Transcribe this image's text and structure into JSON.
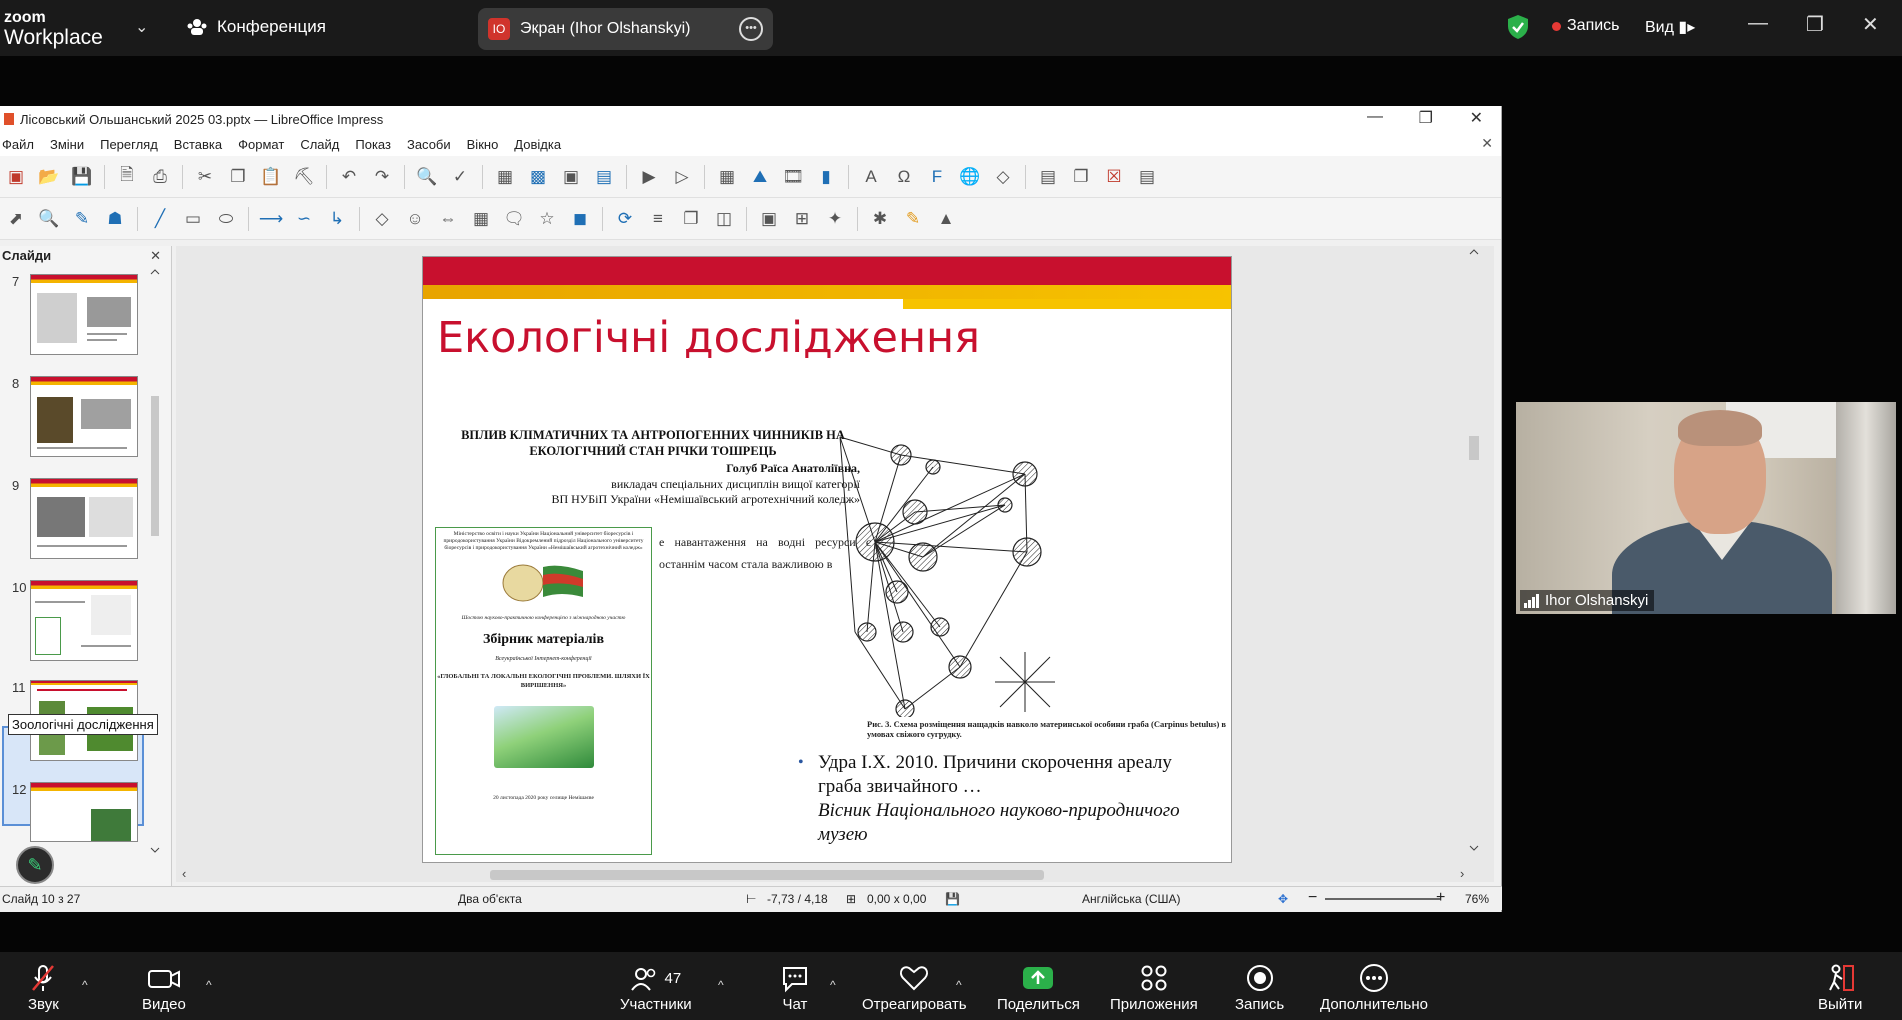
{
  "zoom": {
    "logo_line1": "zoom",
    "logo_line2": "Workplace",
    "meeting_label": "Конференция",
    "screen_share_label": "Экран (Ihor Olshanskyi)",
    "screen_share_badge": "IO",
    "recording_label": "Запись",
    "view_label": "Вид",
    "participant_name": "Ihor Olshanskyi",
    "participants_count": "47",
    "bottom": {
      "audio": "Звук",
      "video": "Видео",
      "participants": "Участники",
      "chat": "Чат",
      "react": "Отреагировать",
      "share": "Поделиться",
      "apps": "Приложения",
      "record": "Запись",
      "more": "Дополнительно",
      "leave": "Выйти"
    },
    "accent_color": "#0e72ed"
  },
  "impress": {
    "window_title": "Лісовський Ольшанський 2025 03.pptx — LibreOffice Impress",
    "menu": [
      "Файл",
      "Зміни",
      "Перегляд",
      "Вставка",
      "Формат",
      "Слайд",
      "Показ",
      "Засоби",
      "Вікно",
      "Довідка"
    ],
    "slides_panel_title": "Слайди",
    "thumb_numbers": [
      "7",
      "8",
      "9",
      "10",
      "11",
      "12"
    ],
    "tooltip": "Зоологічні дослідження",
    "status": {
      "slide": "Слайд 10 з 27",
      "selection": "Два об'єкта",
      "position": "-7,73 / 4,18",
      "size": "0,00 x 0,00",
      "language": "Англійська (США)",
      "zoom": "76%"
    }
  },
  "slide": {
    "title": "Екологічні дослідження",
    "article_heading": "ВПЛИВ КЛІМАТИЧНИХ ТА АНТРОПОГЕННИХ ЧИННИКІВ НА ЕКОЛОГІЧНИЙ СТАН РІЧКИ ТОШРЕЦЬ",
    "author": "Голуб Раїса Анатоліївна,",
    "author_line2": "викладач спеціальних дисциплін вищої категорії",
    "author_line3": "ВП НУБіП України «Немішаївський агротехнічний коледж»",
    "cover_header": "Міністерство освіти і науки України Національний університет біоресурсів і природокористування України Відокремлений підрозділ Національного університету біоресурсів і природокористування України «Немішаївський агротехнічний коледж»",
    "cover_sub": "Шостою науково-практичною конференцією з міжнародною участю",
    "cover_title": "Збірник матеріалів",
    "cover_conf": "Всеукраїнської Інтернет-конференції",
    "cover_theme": "«ГЛОБАЛЬНІ ТА ЛОКАЛЬНІ ЕКОЛОГІЧНІ ПРОБЛЕМИ. ШЛЯХИ ЇХ ВИРІШЕННЯ»",
    "cover_footer": "20 листопада 2020 року селище Немішаєве",
    "body_text": "е навантаження на водні ресурси є останнім часом стала важливою в",
    "figure_caption": "Рис. 3. Схема розміщення нащадків навколо материнської особини граба (Carpinus betulus) в умовах свіжого сугрудку.",
    "reference_main": "Удра І.Х. 2010. Причини скорочення ареалу граба звичайного …",
    "reference_journal": "Вісник Національного науково-природничого музею",
    "brand_red": "#c8102e",
    "brand_yellow": "#f7c300"
  }
}
